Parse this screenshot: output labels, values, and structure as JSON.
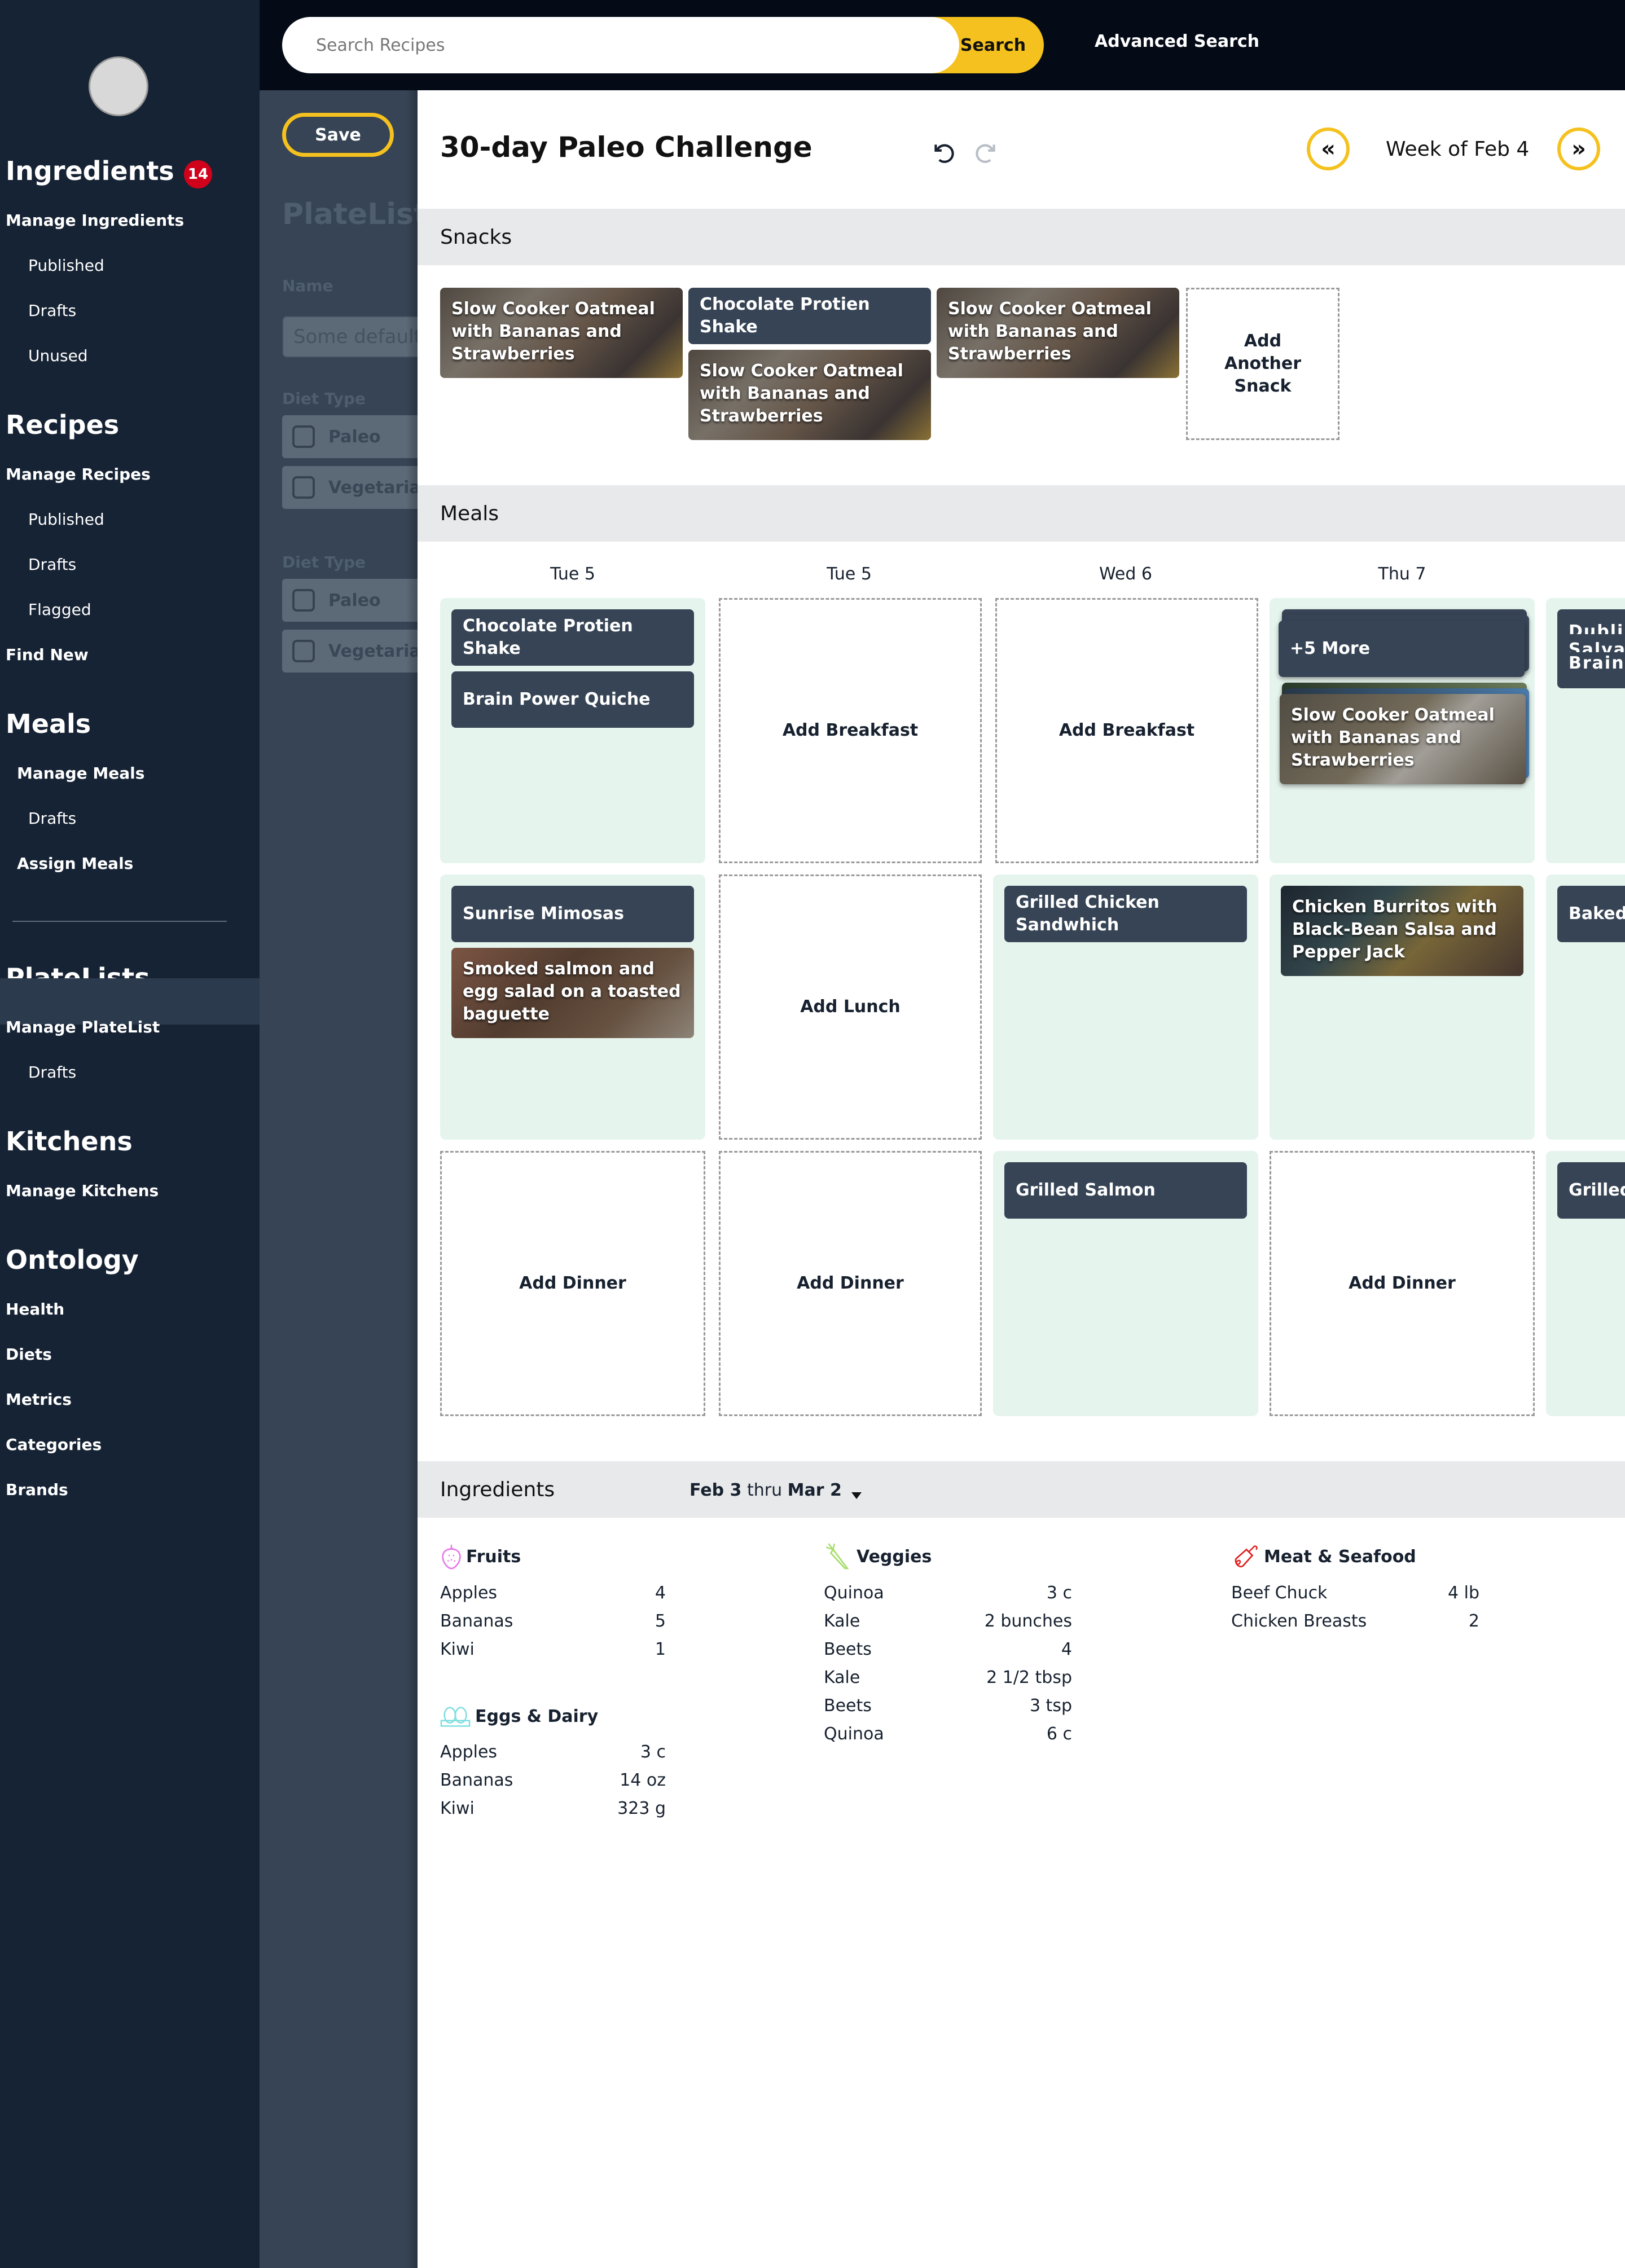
{
  "sidebar": {
    "ingredients": {
      "heading": "Ingredients",
      "badge": "14",
      "manage": "Manage Ingredients",
      "items": [
        "Published",
        "Drafts",
        "Unused"
      ]
    },
    "recipes": {
      "heading": "Recipes",
      "manage": "Manage Recipes",
      "items": [
        "Published",
        "Drafts",
        "Flagged"
      ],
      "find_new": "Find New"
    },
    "meals": {
      "heading": "Meals",
      "manage": "Manage Meals",
      "drafts": "Drafts",
      "assign": "Assign Meals"
    },
    "platelists": {
      "heading": "PlateLists",
      "manage": "Manage PlateList",
      "drafts": "Drafts"
    },
    "kitchens": {
      "heading": "Kitchens",
      "manage": "Manage Kitchens"
    },
    "ontology": {
      "heading": "Ontology",
      "items": [
        "Health",
        "Diets",
        "Metrics",
        "Categories",
        "Brands"
      ]
    }
  },
  "topbar": {
    "search_placeholder": "Search Recipes",
    "search_button": "Search",
    "advanced_search": "Advanced Search"
  },
  "panel": {
    "save": "Save",
    "title": "PlateList",
    "name_label": "Name",
    "name_placeholder": "Some default",
    "diet_groups": [
      {
        "label": "Diet Type",
        "options": [
          "Paleo",
          "Vegetarian"
        ]
      },
      {
        "label": "Diet Type",
        "options": [
          "Paleo",
          "Vegetarian"
        ]
      }
    ]
  },
  "main": {
    "title": "30-day Paleo Challenge",
    "week_label": "Week of Feb 4",
    "week_prev": "«",
    "week_next": "»",
    "snacks": {
      "heading": "Snacks",
      "cards": [
        "Slow Cooker Oatmeal with Bananas and Strawberries",
        "Chocolate Protien Shake",
        "Slow Cooker Oatmeal with Bananas and Strawberries",
        "Slow Cooker Oatmeal with Bananas and Strawberries"
      ],
      "add": "Add Another Snack"
    },
    "meals": {
      "heading": "Meals",
      "days": [
        "Tue 5",
        "Tue 5",
        "Wed 6",
        "Thu 7"
      ],
      "breakfast": {
        "col0": [
          "Chocolate Protien Shake",
          "Brain Power Quiche"
        ],
        "add": "Add Breakfast",
        "col3_more": "+5 More",
        "col3_card": "Slow Cooker Oatmeal with Bananas and Strawberries",
        "col4_lines": [
          "Dublin",
          "Salvador",
          "Brain P"
        ]
      },
      "lunch": {
        "col0": [
          "Sunrise Mimosas",
          "Smoked salmon and egg salad on a toasted baguette"
        ],
        "add": "Add Lunch",
        "col2": "Grilled Chicken Sandwhich",
        "col3": "Chicken Burritos with Black-Bean Salsa and Pepper Jack",
        "col4": "Baked I"
      },
      "dinner": {
        "add": "Add Dinner",
        "col2": "Grilled Salmon",
        "col4": "Grilled"
      }
    },
    "ingredients": {
      "heading": "Ingredients",
      "range_start": "Feb 3",
      "range_sep": "thru",
      "range_end": "Mar 2",
      "groups": [
        {
          "name": "Fruits",
          "icon": "strawberry-icon",
          "color": "#e879e8",
          "items": [
            [
              "Apples",
              "4"
            ],
            [
              "Bananas",
              "5"
            ],
            [
              "Kiwi",
              "1"
            ]
          ]
        },
        {
          "name": "Eggs & Dairy",
          "icon": "eggs-icon",
          "color": "#7fdede",
          "items": [
            [
              "Apples",
              "3 c"
            ],
            [
              "Bananas",
              "14 oz"
            ],
            [
              "Kiwi",
              "323 g"
            ]
          ]
        },
        {
          "name": "Veggies",
          "icon": "carrot-icon",
          "color": "#a6dd6a",
          "items": [
            [
              "Quinoa",
              "3 c"
            ],
            [
              "Kale",
              "2 bunches"
            ],
            [
              "Beets",
              "4"
            ],
            [
              "Kale",
              "2 1/2 tbsp"
            ],
            [
              "Beets",
              "3 tsp"
            ],
            [
              "Quinoa",
              "6 c"
            ]
          ]
        },
        {
          "name": "Meat & Seafood",
          "icon": "drumstick-icon",
          "color": "#e02020",
          "items": [
            [
              "Beef Chuck",
              "4 lb"
            ],
            [
              "Chicken Breasts",
              "2"
            ]
          ]
        }
      ]
    }
  },
  "colors": {
    "accent": "#f5c11e",
    "sidebar": "#162334",
    "card": "#364455",
    "slot_filled": "#e6f4ee",
    "badge": "#d0021b"
  }
}
